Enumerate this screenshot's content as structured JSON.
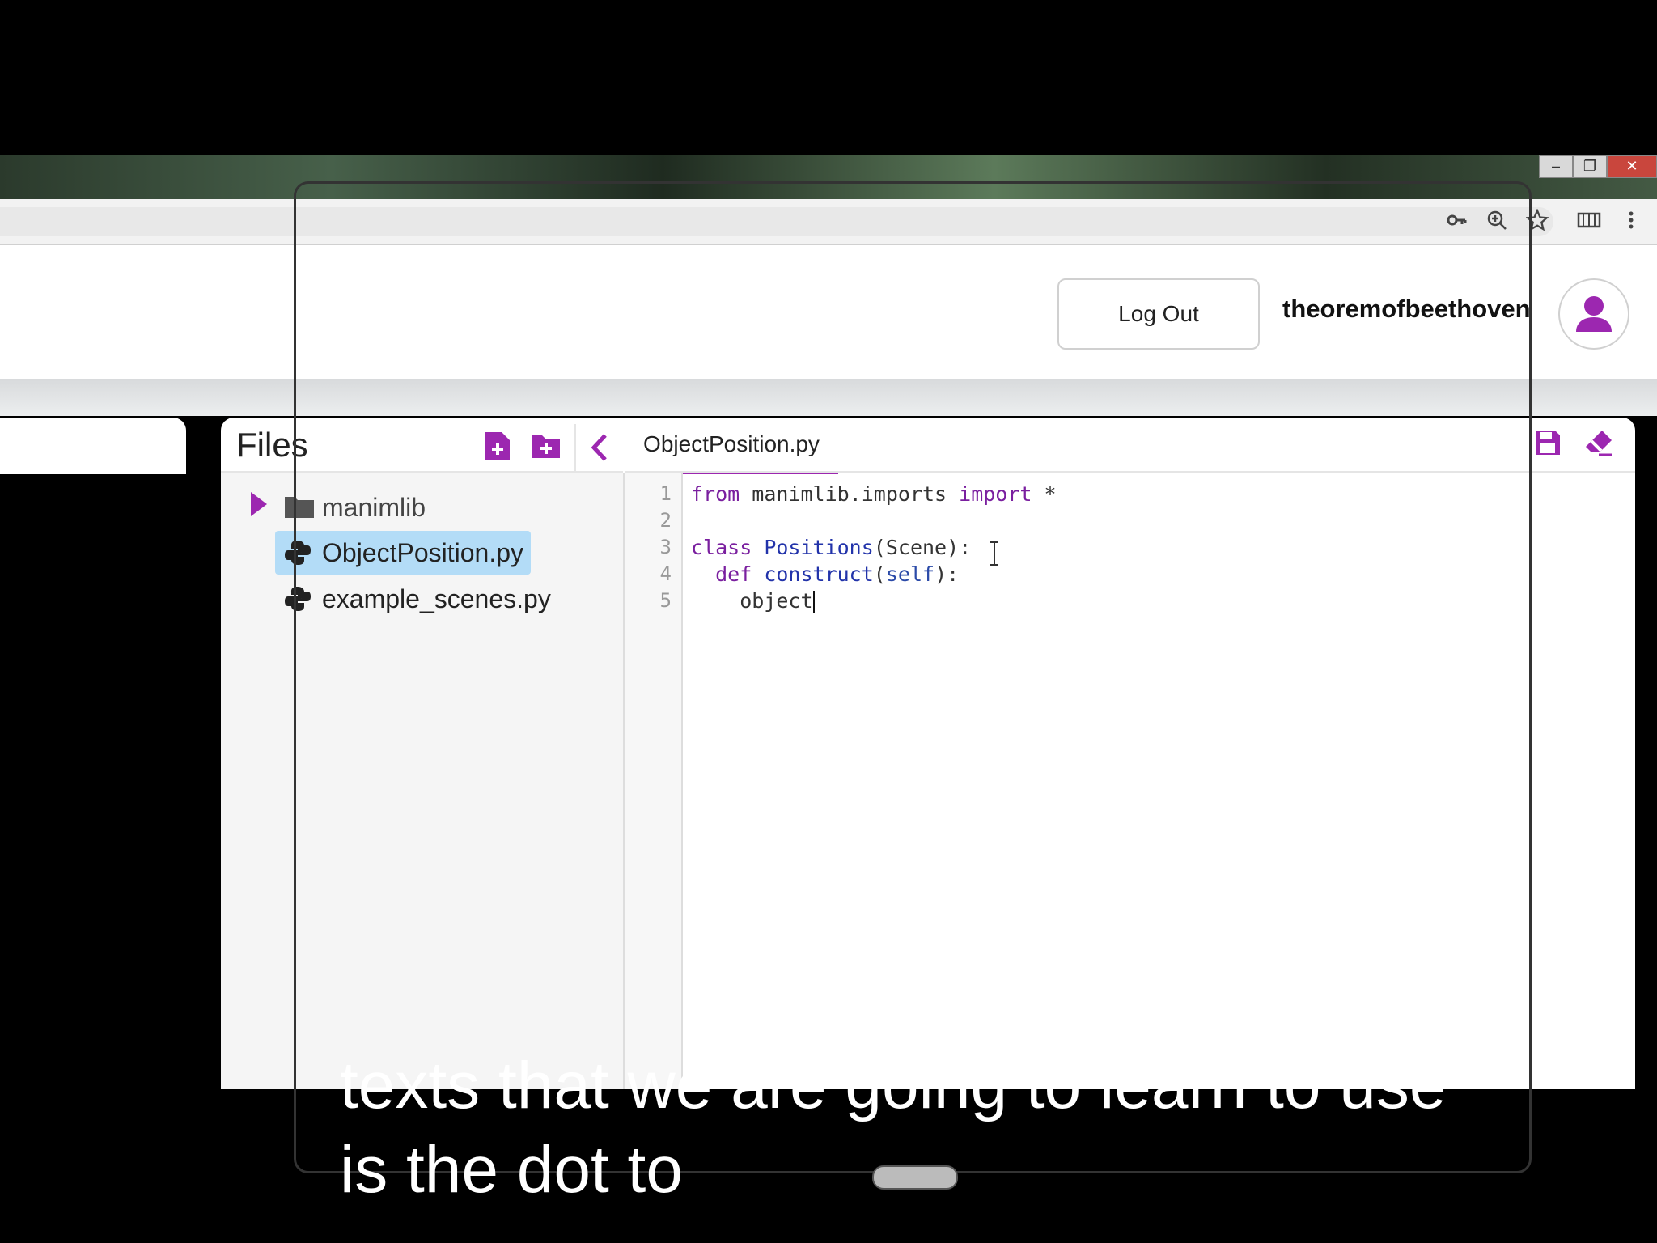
{
  "browser": {
    "window_controls": [
      "‒",
      "❐",
      "✕"
    ],
    "toolbar_icons": [
      "key-icon",
      "zoom-icon",
      "star-icon",
      "extension-icon",
      "menu-icon"
    ]
  },
  "header": {
    "logout_label": "Log Out",
    "username": "theoremofbeethoven"
  },
  "files": {
    "title": "Files",
    "tree": [
      {
        "name": "manimlib",
        "type": "folder"
      },
      {
        "name": "ObjectPosition.py",
        "type": "file",
        "selected": true
      },
      {
        "name": "example_scenes.py",
        "type": "file"
      }
    ]
  },
  "editor": {
    "tab": "ObjectPosition.py",
    "line_numbers": [
      "1",
      "2",
      "3",
      "4",
      "5"
    ],
    "lines": [
      [
        {
          "t": "from",
          "c": "kw"
        },
        {
          "t": " manimlib.imports ",
          "c": ""
        },
        {
          "t": "import",
          "c": "kw"
        },
        {
          "t": " *",
          "c": ""
        }
      ],
      [],
      [
        {
          "t": "class",
          "c": "kw"
        },
        {
          "t": " ",
          "c": ""
        },
        {
          "t": "Positions",
          "c": "def"
        },
        {
          "t": "(Scene):",
          "c": ""
        }
      ],
      [
        {
          "t": "  def",
          "c": "kw"
        },
        {
          "t": " ",
          "c": ""
        },
        {
          "t": "construct",
          "c": "def"
        },
        {
          "t": "(",
          "c": ""
        },
        {
          "t": "self",
          "c": "var"
        },
        {
          "t": "):",
          "c": ""
        }
      ],
      [
        {
          "t": "    object",
          "c": ""
        }
      ]
    ]
  },
  "subtitle": {
    "line1": "texts that we are going to learn to use",
    "line2": "is the dot to"
  },
  "colors": {
    "accent": "#9c27b0",
    "selection": "#b3dcf7"
  }
}
